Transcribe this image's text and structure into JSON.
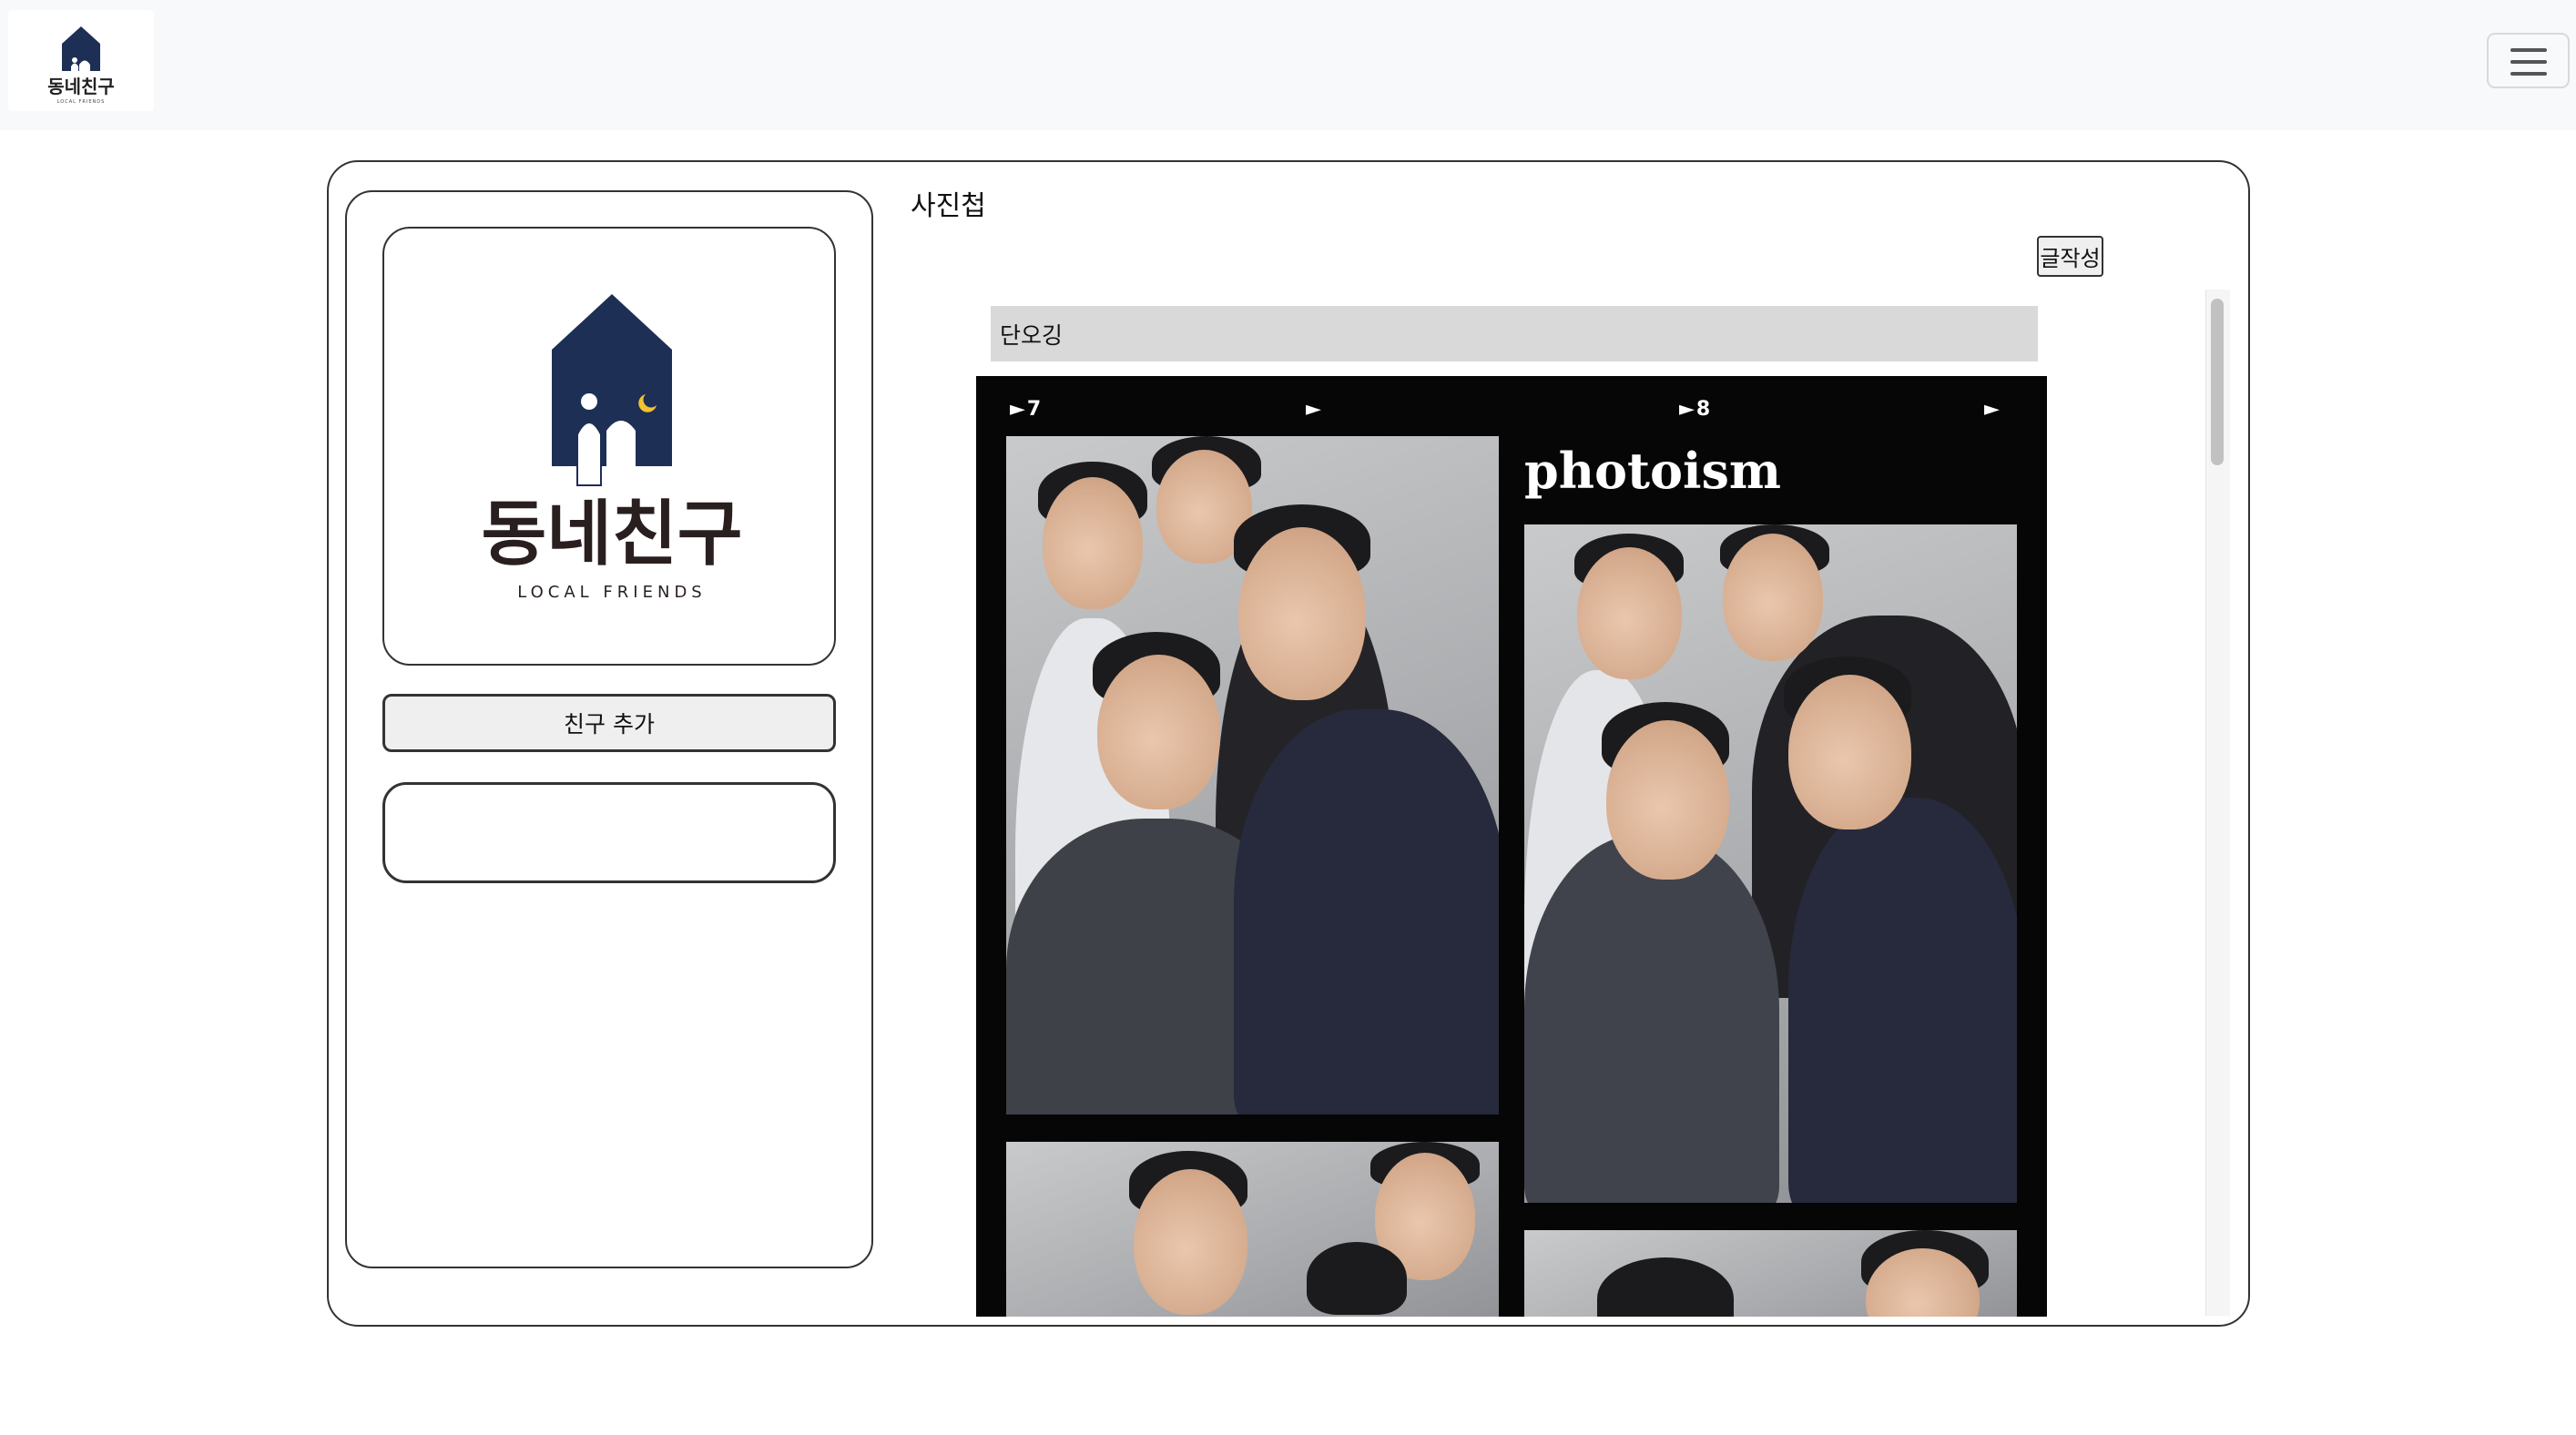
{
  "brand": {
    "name": "동네친구",
    "tagline": "LOCAL FRIENDS",
    "colors": {
      "navy": "#1e2f55",
      "moon": "#f2c230",
      "text": "#222222"
    }
  },
  "navbar": {
    "menu_icon": "hamburger-menu-icon"
  },
  "sidebar": {
    "add_friend_label": "친구 추가"
  },
  "main": {
    "title": "사진첩",
    "write_label": "글작성",
    "post": {
      "title": "단오깅",
      "photo": {
        "brand_text": "photoism",
        "frame_labels": [
          "►7",
          "►",
          "►8",
          "►"
        ]
      }
    }
  }
}
